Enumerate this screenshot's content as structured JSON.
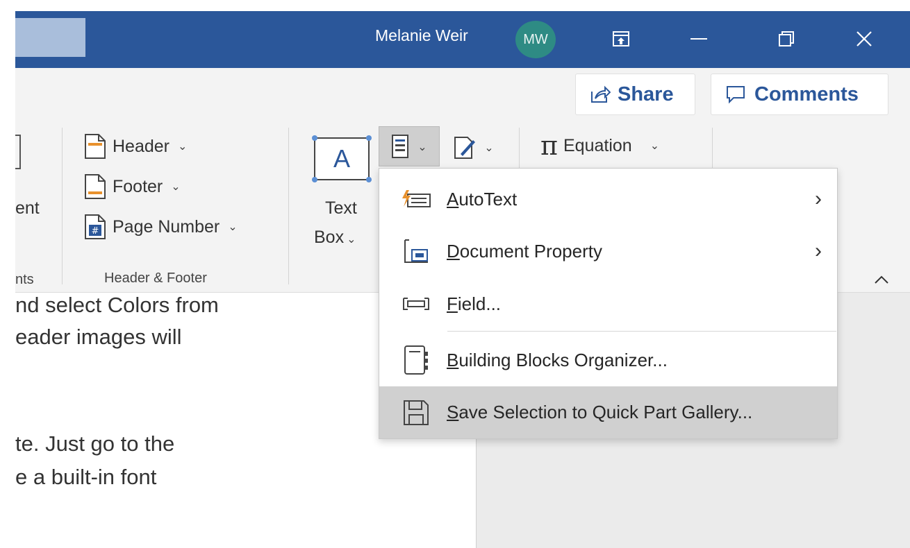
{
  "titlebar": {
    "user_name": "Melanie Weir",
    "avatar_initials": "MW",
    "accent": "#2b579a"
  },
  "ribbon": {
    "share_label": "Share",
    "comments_label": "Comments",
    "partial_left_text": "ent",
    "partial_left_group": "nts",
    "header_label": "Header",
    "footer_label": "Footer",
    "page_number_label": "Page Number",
    "header_footer_group": "Header & Footer",
    "textbox_line1": "Text",
    "textbox_line2": "Box",
    "textbox_glyph": "A",
    "equation_label": "Equation",
    "pi_glyph": "π"
  },
  "menu": {
    "items": [
      {
        "first": "A",
        "rest": "utoText",
        "has_submenu": true
      },
      {
        "first": "D",
        "rest": "ocument Property",
        "has_submenu": true
      },
      {
        "first": "F",
        "rest": "ield...",
        "has_submenu": false
      },
      {
        "first": "B",
        "rest": "uilding Blocks Organizer...",
        "has_submenu": false
      },
      {
        "first": "S",
        "rest": "ave Selection to Quick Part Gallery...",
        "has_submenu": false
      }
    ]
  },
  "document": {
    "lines": [
      "nd select Colors from",
      "eader images will",
      "te.  Just go to the",
      "e a built-in font"
    ]
  }
}
